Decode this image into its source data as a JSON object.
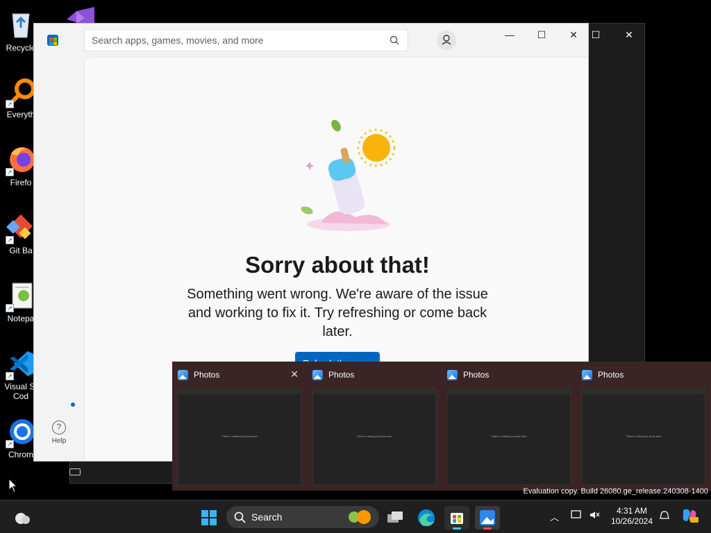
{
  "desktop": {
    "icons": [
      {
        "label": "Recycle",
        "icon": "recycle-bin-icon"
      },
      {
        "label": "Everyth",
        "icon": "everything-search-icon"
      },
      {
        "label": "Firefo",
        "icon": "firefox-icon"
      },
      {
        "label": "Git Ba",
        "icon": "git-bash-icon"
      },
      {
        "label": "Notepa",
        "icon": "notepad-plus-plus-icon"
      },
      {
        "label": "Visual St",
        "label2": "Cod",
        "icon": "vscode-icon"
      },
      {
        "label": "Chrom",
        "icon": "chrome-icon"
      }
    ]
  },
  "store": {
    "search_placeholder": "Search apps, games, movies, and more",
    "error_title": "Sorry about that!",
    "error_message": "Something went wrong. We're aware of the issue and working to fix it. Try refreshing or come back later.",
    "refresh_label": "Refresh the page",
    "help_label": "Help",
    "colors": {
      "accent": "#0067c0"
    }
  },
  "thumbnails": [
    {
      "title": "Photos",
      "preview_text": "There's nothing to show here"
    },
    {
      "title": "Photos",
      "preview_text": "There's nothing to show here"
    },
    {
      "title": "Photos",
      "preview_text": "There's nothing to show here"
    },
    {
      "title": "Photos",
      "preview_text": "There's nothing to show here"
    }
  ],
  "watermark": "Evaluation copy. Build 26080.ge_release.240308-1400",
  "taskbar": {
    "search_label": "Search",
    "time": "4:31 AM",
    "date": "10/26/2024"
  }
}
